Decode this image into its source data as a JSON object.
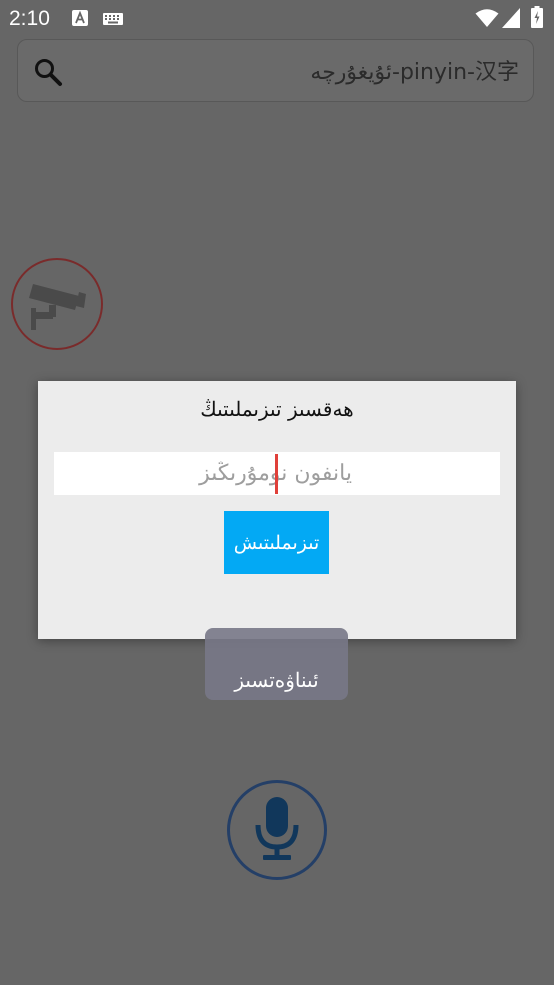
{
  "status_bar": {
    "time": "2:10",
    "icons": [
      "a-notification-icon",
      "keyboard-icon",
      "wifi-icon",
      "signal-icon",
      "battery-icon"
    ]
  },
  "search": {
    "text": "ئۇيغۇرچە-pinyin-汉字",
    "icon": "search-icon"
  },
  "camera_button": {
    "icon": "camera-icon",
    "border_color": "#7a2b2b"
  },
  "mic_button": {
    "icon": "microphone-icon",
    "border_color": "#243f67"
  },
  "dialog": {
    "title": "ھەقسىز تىزىملىتىڭ",
    "phone_placeholder": "يانفون نومۇرىڭىز",
    "confirm_label": "تىزىملىتىش"
  },
  "toast": {
    "text": "ئىناۋەتسىز"
  },
  "colors": {
    "overlay_background": "#666666",
    "dialog_background": "#ececec",
    "accent": "#03a9f4",
    "caret": "#e0403a"
  }
}
